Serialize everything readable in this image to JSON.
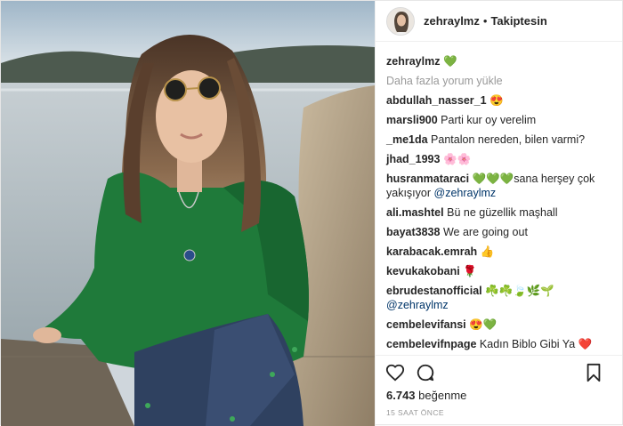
{
  "header": {
    "username": "zehraylmz",
    "separator": "•",
    "follow_label": "Takiptesin"
  },
  "caption": {
    "username": "zehraylmz",
    "text": "💚"
  },
  "load_more": "Daha fazla yorum yükle",
  "comments": [
    {
      "user": "abdullah_nasser_1",
      "text": "😍"
    },
    {
      "user": "marsli900",
      "text": "Parti kur oy verelim"
    },
    {
      "user": "_me1da",
      "text": "Pantalon nereden, bilen varmi?"
    },
    {
      "user": "jhad_1993",
      "text": "🌸🌸"
    },
    {
      "user": "husranmataraci",
      "text": "💚💚💚sana herşey çok yakışıyor",
      "mention": "@zehraylmz"
    },
    {
      "user": "ali.mashtel",
      "text": "Bü ne güzellik maşhall"
    },
    {
      "user": "bayat3838",
      "text": "We are going out"
    },
    {
      "user": "karabacak.emrah",
      "text": "👍"
    },
    {
      "user": "kevukakobani",
      "text": "🌹"
    },
    {
      "user": "ebrudestanofficial",
      "text": "☘️☘️🍃🌿🌱",
      "mention": "@zehraylmz"
    },
    {
      "user": "cembelevifansi",
      "text": "😍💚"
    },
    {
      "user": "cembelevifnpage",
      "text": "Kadın Biblo Gibi Ya ❤️"
    }
  ],
  "stats": {
    "likes_count": "6.743",
    "likes_label": "beğenme"
  },
  "timestamp": "15 SAAT ÖNCE",
  "icons": {
    "like": "heart-icon",
    "comment": "comment-icon",
    "save": "bookmark-icon"
  }
}
